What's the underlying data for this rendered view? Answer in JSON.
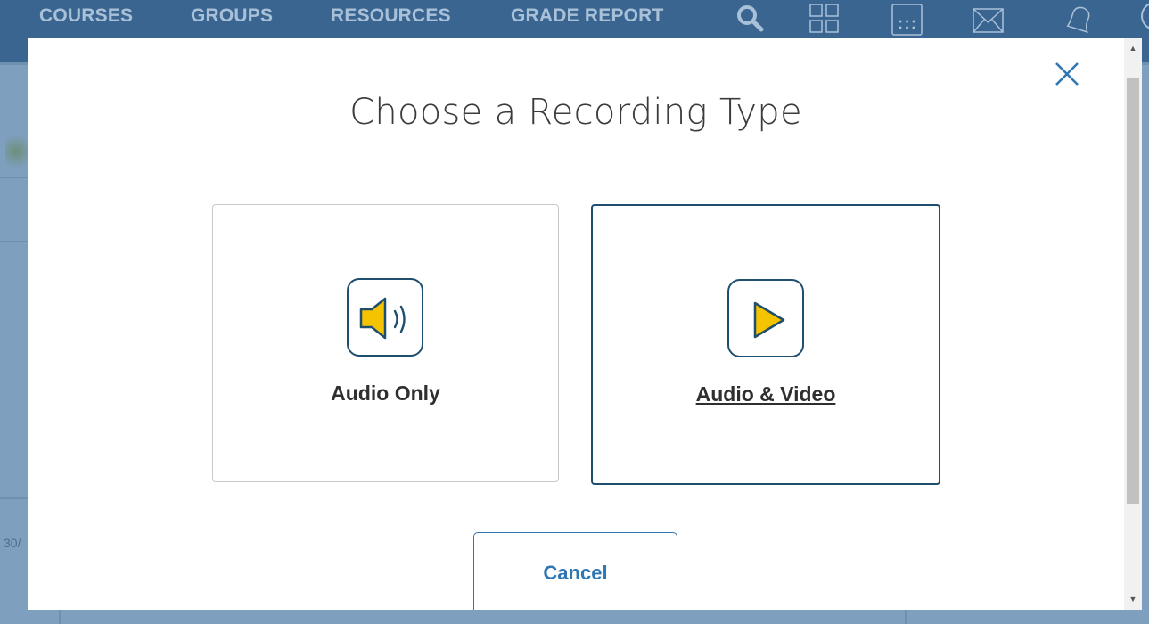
{
  "nav": {
    "items": [
      {
        "label": "COURSES"
      },
      {
        "label": "GROUPS"
      },
      {
        "label": "RESOURCES"
      },
      {
        "label": "GRADE REPORT"
      }
    ],
    "icons": [
      "search-icon",
      "apps-grid-icon",
      "calendar-icon",
      "mail-icon",
      "bell-icon"
    ]
  },
  "background": {
    "partial_text": "30/"
  },
  "modal": {
    "title": "Choose a Recording Type",
    "options": [
      {
        "label": "Audio Only",
        "icon": "speaker-icon",
        "selected": false
      },
      {
        "label": "Audio & Video",
        "icon": "play-icon",
        "selected": true
      }
    ],
    "cancel_label": "Cancel"
  },
  "colors": {
    "nav_bg": "#3a6590",
    "accent_blue": "#2f77b2",
    "icon_border": "#1f4e6e",
    "icon_fill": "#f5c400",
    "overlay_bg": "#7e9fbe"
  }
}
